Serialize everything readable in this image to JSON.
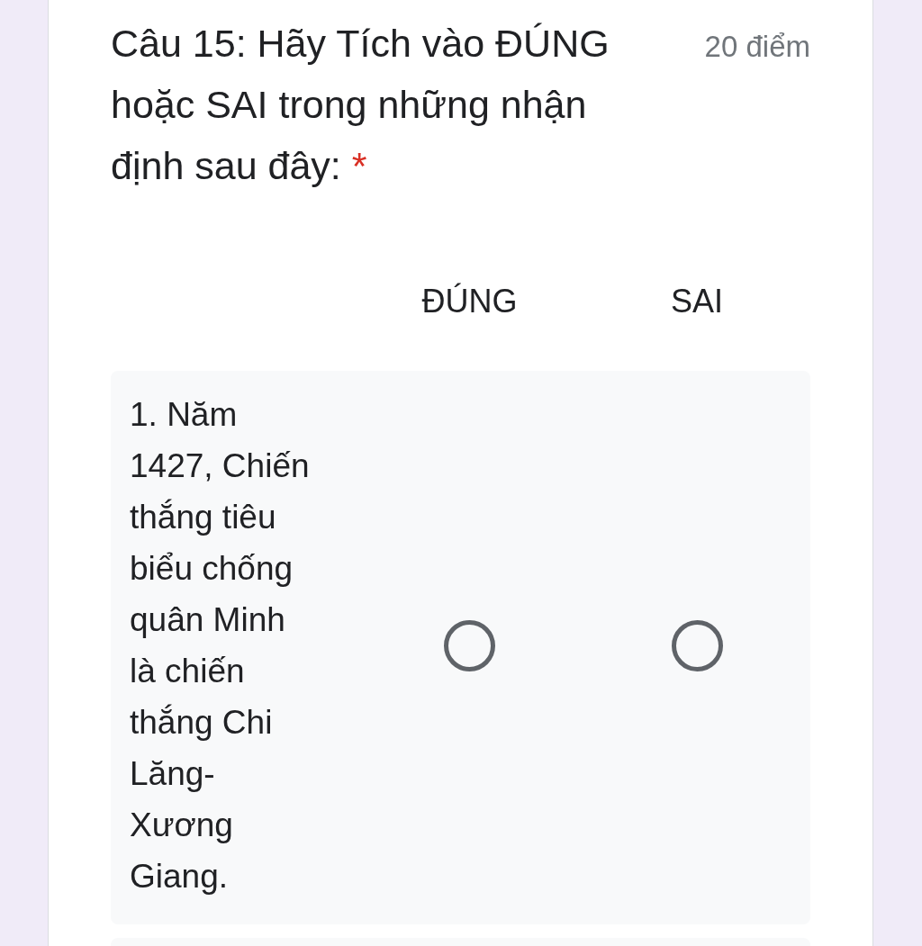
{
  "question": {
    "title": "Câu 15: Hãy Tích vào ĐÚNG hoặc SAI trong những nhận định sau đây:",
    "required_mark": "*",
    "points": "20 điểm"
  },
  "grid": {
    "columns": [
      "ĐÚNG",
      "SAI"
    ],
    "rows": [
      {
        "label": "1. Năm 1427, Chiến thắng tiêu biểu chống quân Minh là chiến thắng Chi Lăng- Xương Giang.",
        "choices": [
          {
            "selected": false
          },
          {
            "selected": false
          }
        ]
      }
    ]
  }
}
